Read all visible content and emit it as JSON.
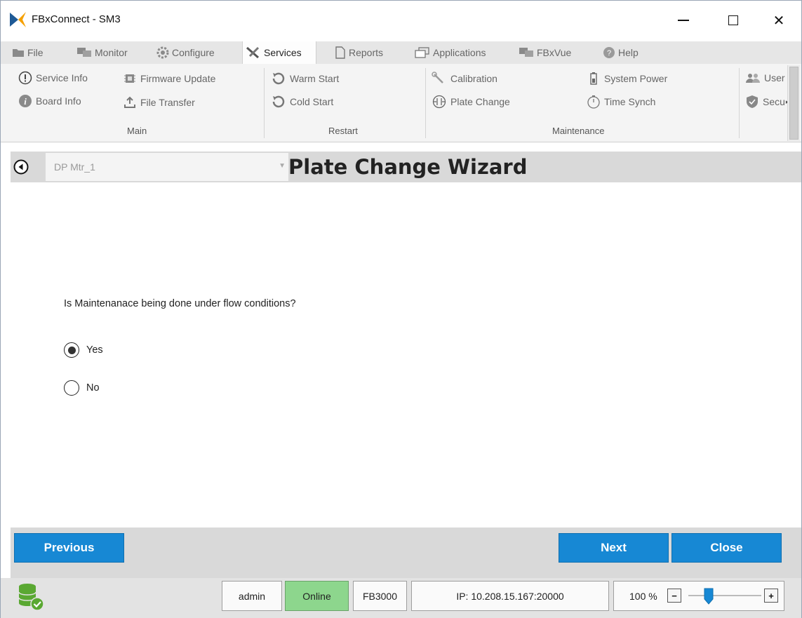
{
  "window": {
    "title": "FBxConnect - SM3"
  },
  "menu": {
    "items": [
      {
        "label": "File",
        "icon": "folder-icon"
      },
      {
        "label": "Monitor",
        "icon": "monitor-icon"
      },
      {
        "label": "Configure",
        "icon": "gear-icon"
      },
      {
        "label": "Services",
        "icon": "tools-icon",
        "active": true
      },
      {
        "label": "Reports",
        "icon": "document-icon"
      },
      {
        "label": "Applications",
        "icon": "windows-icon"
      },
      {
        "label": "FBxVue",
        "icon": "monitor-icon"
      },
      {
        "label": "Help",
        "icon": "help-icon"
      }
    ]
  },
  "ribbon": {
    "groups": [
      {
        "label": "Main",
        "items": [
          {
            "label": "Service Info",
            "icon": "info-circle-icon"
          },
          {
            "label": "Board Info",
            "icon": "info-filled-icon"
          },
          {
            "label": "Firmware Update",
            "icon": "chip-icon"
          },
          {
            "label": "File Transfer",
            "icon": "upload-icon"
          }
        ]
      },
      {
        "label": "Restart",
        "items": [
          {
            "label": "Warm Start",
            "icon": "restart-icon"
          },
          {
            "label": "Cold Start",
            "icon": "restart-icon"
          }
        ]
      },
      {
        "label": "Maintenance",
        "items": [
          {
            "label": "Calibration",
            "icon": "wrench-icon"
          },
          {
            "label": "Plate Change",
            "icon": "plate-icon"
          },
          {
            "label": "System Power",
            "icon": "battery-icon"
          },
          {
            "label": "Time Synch",
            "icon": "stopwatch-icon"
          }
        ]
      },
      {
        "label": "",
        "items": [
          {
            "label": "User",
            "icon": "users-icon"
          },
          {
            "label": "Secu",
            "icon": "shield-icon"
          }
        ]
      }
    ]
  },
  "wizard": {
    "device": "DP Mtr_1",
    "title": "Plate Change Wizard",
    "question": "Is Maintenanace being done under flow conditions?",
    "options": [
      {
        "label": "Yes",
        "selected": true
      },
      {
        "label": "No",
        "selected": false
      }
    ],
    "buttons": {
      "previous": "Previous",
      "next": "Next",
      "close": "Close"
    }
  },
  "status": {
    "user": "admin",
    "connection": "Online",
    "device": "FB3000",
    "ip": "IP: 10.208.15.167:20000",
    "zoom": "100 %",
    "zoom_minus": "−",
    "zoom_plus": "+"
  },
  "colors": {
    "accent": "#1788d4",
    "online": "#8dd68d"
  }
}
